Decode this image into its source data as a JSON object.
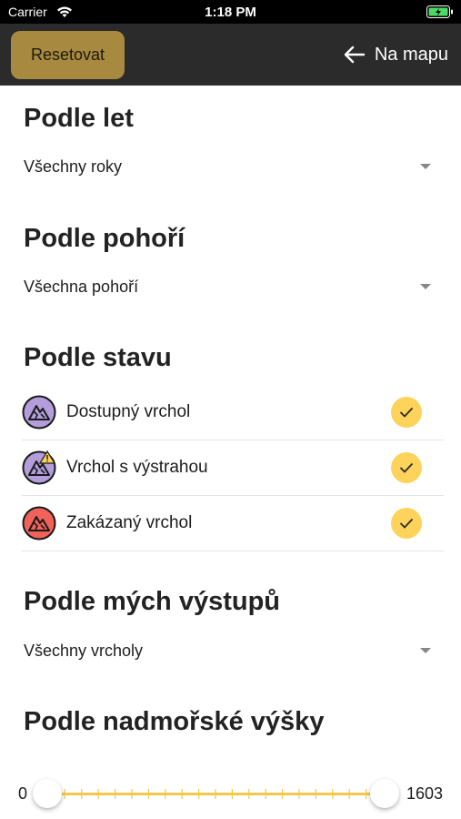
{
  "status_bar": {
    "carrier": "Carrier",
    "time": "1:18 PM"
  },
  "nav": {
    "reset_label": "Resetovat",
    "back_label": "Na mapu"
  },
  "sections": {
    "years": {
      "title": "Podle let",
      "selected": "Všechny roky"
    },
    "ranges": {
      "title": "Podle pohoří",
      "selected": "Všechna pohoří"
    },
    "state": {
      "title": "Podle stavu",
      "items": [
        {
          "label": "Dostupný vrchol",
          "icon": "available-peak-icon",
          "checked": true
        },
        {
          "label": "Vrchol s výstrahou",
          "icon": "warning-peak-icon",
          "checked": true
        },
        {
          "label": "Zakázaný vrchol",
          "icon": "forbidden-peak-icon",
          "checked": true
        }
      ]
    },
    "climbs": {
      "title": "Podle mých výstupů",
      "selected": "Všechny vrcholy"
    },
    "altitude": {
      "title": "Podle nadmořské výšky",
      "min": "0",
      "max": "1603"
    }
  },
  "colors": {
    "accent": "#fdd35c",
    "reset_button": "#a78a3f",
    "nav_bg": "#2b2b2b",
    "available": "#b39ddb",
    "forbidden": "#f0625a"
  }
}
